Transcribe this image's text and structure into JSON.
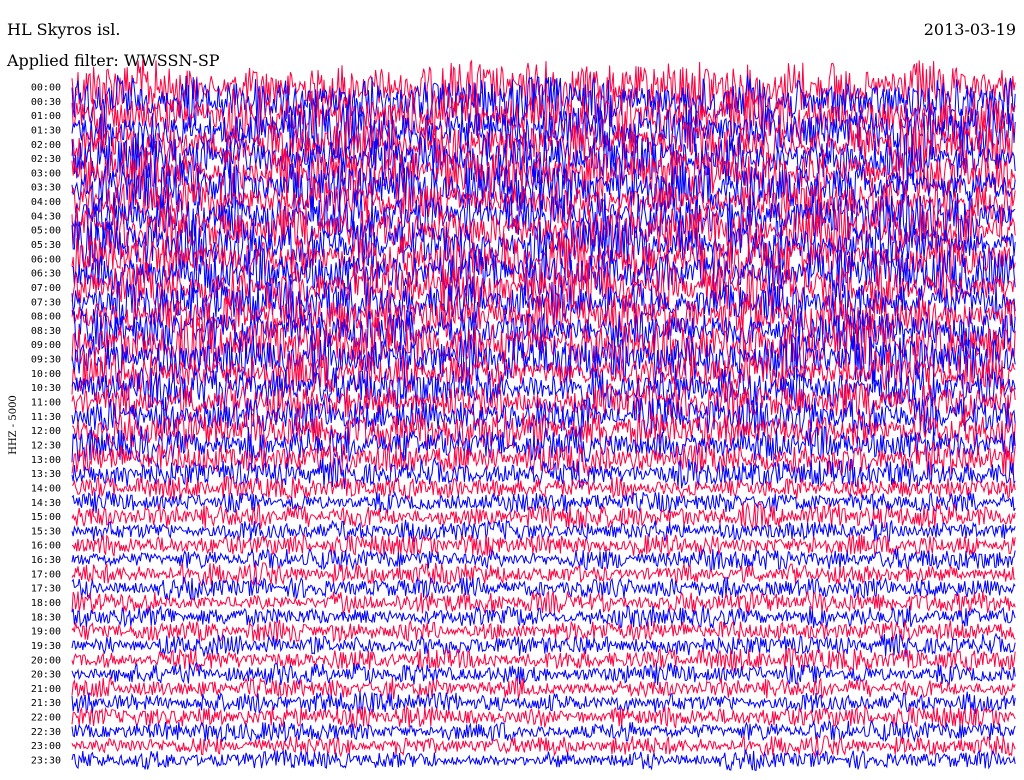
{
  "header": {
    "station": "HL Skyros isl.",
    "date": "2013-03-19",
    "filter": "Applied filter: WWSSN-SP"
  },
  "chart_data": {
    "type": "line",
    "title": "HL Skyros isl.",
    "date": "2013-03-19",
    "filter": "Applied filter: WWSSN-SP",
    "ylabel": "HHZ - 5000",
    "row_labels": [
      "00:00",
      "00:30",
      "01:00",
      "01:30",
      "02:00",
      "02:30",
      "03:00",
      "03:30",
      "04:00",
      "04:30",
      "05:00",
      "05:30",
      "06:00",
      "06:30",
      "07:00",
      "07:30",
      "08:00",
      "08:30",
      "09:00",
      "09:30",
      "10:00",
      "10:30",
      "11:00",
      "11:30",
      "12:00",
      "12:30",
      "13:00",
      "13:30",
      "14:00",
      "14:30",
      "15:00",
      "15:30",
      "16:00",
      "16:30",
      "17:00",
      "17:30",
      "18:00",
      "18:30",
      "19:00",
      "19:30",
      "20:00",
      "20:30",
      "21:00",
      "21:30",
      "22:00",
      "22:30",
      "23:00",
      "23:30"
    ],
    "series_colors": [
      "#ff0040",
      "#0000ff"
    ],
    "x_span_minutes": 30,
    "relative_amplitude": [
      2.2,
      2.2,
      2.2,
      2.1,
      2.1,
      2.1,
      2.0,
      2.0,
      2.0,
      2.0,
      2.0,
      2.0,
      2.0,
      2.0,
      2.0,
      1.9,
      1.9,
      1.9,
      2.3,
      2.0,
      1.8,
      1.7,
      1.7,
      1.6,
      1.6,
      1.5,
      1.4,
      1.2,
      0.9,
      0.9,
      1.1,
      0.9,
      0.9,
      0.9,
      0.9,
      0.9,
      0.9,
      0.9,
      0.9,
      0.9,
      0.9,
      0.9,
      0.9,
      0.9,
      0.9,
      0.9,
      0.8,
      0.8
    ]
  }
}
